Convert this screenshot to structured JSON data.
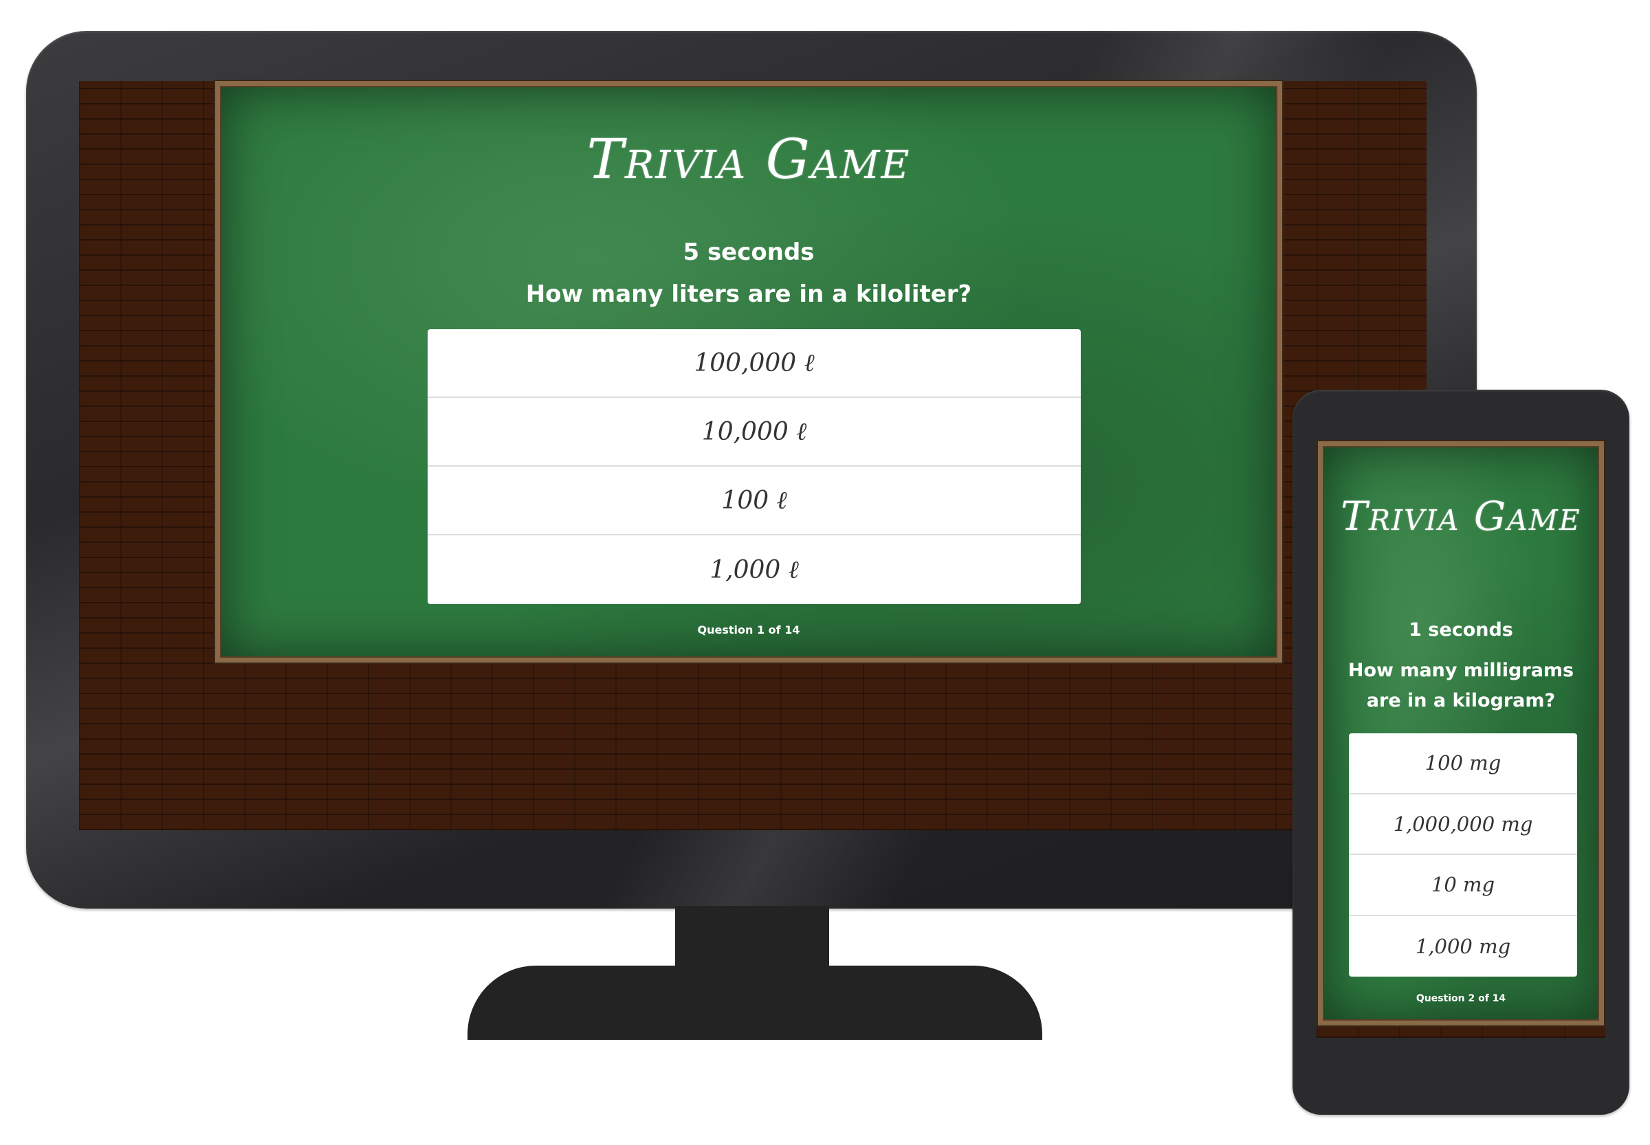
{
  "desktop": {
    "title": "Trivia Game",
    "timer": "5 seconds",
    "question": "How many liters are in a kiloliter?",
    "answers": [
      "100,000 ℓ",
      "10,000 ℓ",
      "100 ℓ",
      "1,000 ℓ"
    ],
    "progress": "Question 1 of 14"
  },
  "phone": {
    "title": "Trivia Game",
    "timer": "1 seconds",
    "question": "How many milligrams are in a kilogram?",
    "answers": [
      "100 mg",
      "1,000,000 mg",
      "10 mg",
      "1,000 mg"
    ],
    "progress": "Question 2 of 14"
  },
  "colors": {
    "chalkboard": "#2d7a3f",
    "frame": "#8a6a48",
    "wall": "#3e1c0c",
    "device": "#232323"
  }
}
